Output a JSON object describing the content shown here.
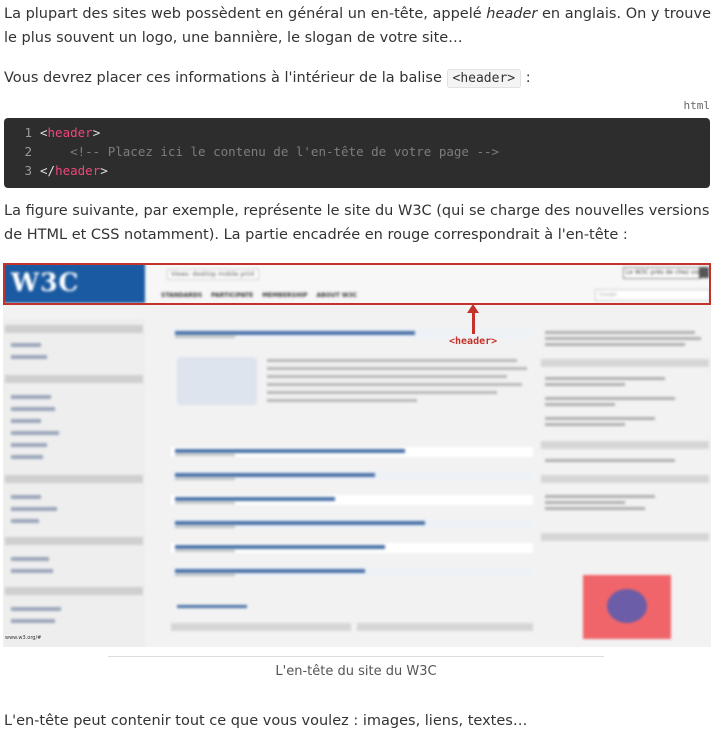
{
  "intro": {
    "before": "La plupart des sites web possèdent en général un en-tête, appelé ",
    "term": "header",
    "after": " en anglais. On y trouve le plus souvent un logo, une bannière, le slogan de votre site…"
  },
  "instruction": {
    "before": "Vous devrez placer ces informations à l'intérieur de la balise ",
    "code": "<header>",
    "after": " :"
  },
  "code_block": {
    "language": "html",
    "lines": [
      {
        "number": "1",
        "open": "<",
        "tag": "header",
        "close": ">"
      },
      {
        "number": "2",
        "comment": "    <!-- Placez ici le contenu de l'en-tête de votre page -->"
      },
      {
        "number": "3",
        "open": "</",
        "tag": "header",
        "close": ">"
      }
    ]
  },
  "figure_intro": "La figure suivante, par exemple, représente le site du W3C (qui se charge des nouvelles versions de HTML et CSS notamment). La partie encadrée en rouge correspondrait à l'en-tête :",
  "figure": {
    "logo": "W3C",
    "views": "Views: desktop mobile print",
    "language_select": "Le W3C près de chez vous",
    "search_placeholder": "Google",
    "nav_items": [
      "STANDARDS",
      "PARTICIPATE",
      "MEMBERSHIP",
      "ABOUT W3C"
    ],
    "annotation": "<header>",
    "footer_url": "www.w3.org/#",
    "caption": "L'en-tête du site du W3C"
  },
  "conclusion": "L'en-tête peut contenir tout ce que vous voulez : images, liens, textes…",
  "colors": {
    "code_bg": "#2d2d2d",
    "tag": "#f0467a",
    "comment": "#7d7d7d",
    "annotation_red": "#c4332a",
    "w3c_blue": "#1a5aa2"
  }
}
